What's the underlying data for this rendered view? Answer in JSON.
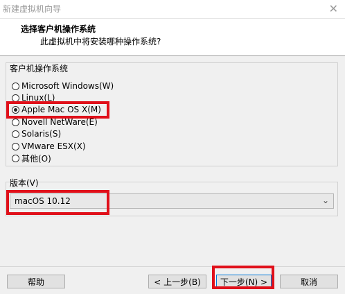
{
  "window": {
    "title": "新建虚拟机向导",
    "close_glyph": "✕"
  },
  "header": {
    "title": "选择客户机操作系统",
    "subtitle": "此虚拟机中将安装哪种操作系统?"
  },
  "os_group": {
    "label": "客户机操作系统",
    "selected": "Apple Mac OS X(M)",
    "options": [
      "Microsoft Windows(W)",
      "Linux(L)",
      "Apple Mac OS X(M)",
      "Novell NetWare(E)",
      "Solaris(S)",
      "VMware ESX(X)",
      "其他(O)"
    ]
  },
  "version": {
    "label": "版本(V)",
    "selected": "macOS 10.12",
    "chevron_icon": "chevron-down-icon"
  },
  "buttons": {
    "help": "帮助",
    "back": "< 上一步(B)",
    "next": "下一步(N) >",
    "cancel": "取消"
  },
  "colors": {
    "highlight": "#e0101a",
    "default_button_border": "#0078d7"
  }
}
